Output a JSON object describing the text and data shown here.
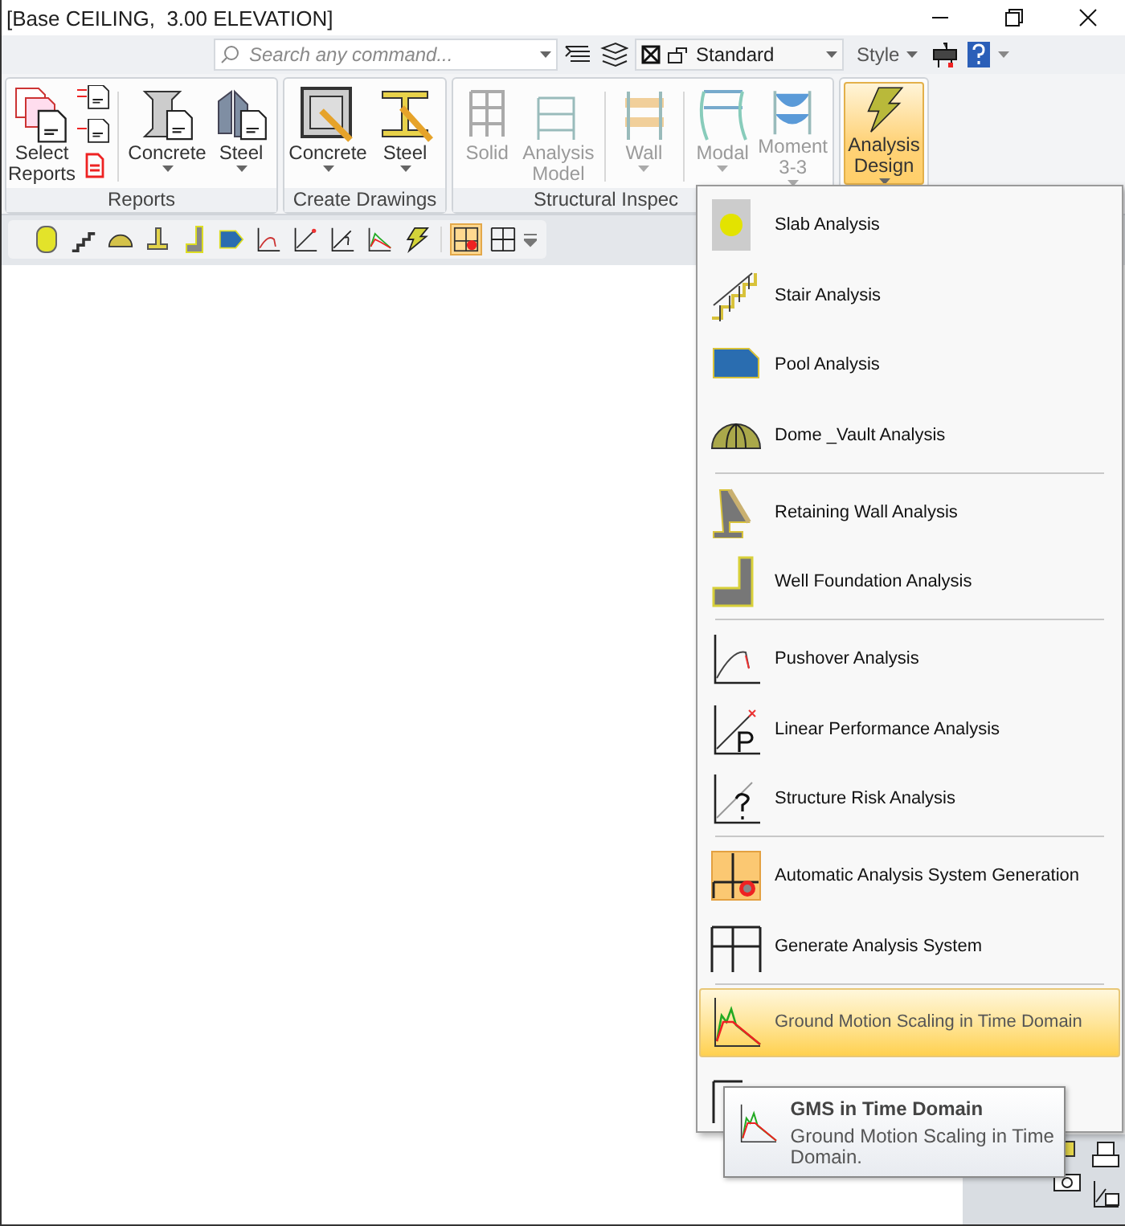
{
  "window": {
    "title": "[Base CEILING,  3.00 ELEVATION]"
  },
  "quick_bar": {
    "search": {
      "placeholder": "Search any command..."
    },
    "view_combo": "Standard",
    "style_combo": "Style"
  },
  "ribbon": {
    "groups": [
      {
        "label": "Reports",
        "buttons": [
          {
            "label": "Select\nReports",
            "dropdown": false,
            "disabled": false,
            "expanded": false
          },
          {
            "label": "Concrete",
            "dropdown": true,
            "disabled": false,
            "expanded": false
          },
          {
            "label": "Steel",
            "dropdown": true,
            "disabled": false,
            "expanded": false
          }
        ]
      },
      {
        "label": "Create Drawings",
        "buttons": [
          {
            "label": "Concrete",
            "dropdown": true,
            "disabled": false,
            "expanded": false
          },
          {
            "label": "Steel",
            "dropdown": true,
            "disabled": false,
            "expanded": false
          }
        ]
      },
      {
        "label": "Structural Inspec",
        "buttons": [
          {
            "label": "Solid",
            "dropdown": false,
            "disabled": true,
            "expanded": false
          },
          {
            "label": "Analysis\nModel",
            "dropdown": false,
            "disabled": true,
            "expanded": false
          },
          {
            "label": "Wall",
            "dropdown": true,
            "disabled": true,
            "expanded": false
          },
          {
            "label": "Modal",
            "dropdown": true,
            "disabled": true,
            "expanded": false
          },
          {
            "label": "Moment\n3-3",
            "dropdown": true,
            "disabled": true,
            "expanded": false
          }
        ]
      },
      {
        "buttons": [
          {
            "label": "Analysis\nDesign",
            "dropdown": true,
            "disabled": false,
            "expanded": true
          }
        ]
      }
    ]
  },
  "toolbar": {
    "tools": [
      {
        "selected": false
      },
      {
        "selected": false
      },
      {
        "selected": false
      },
      {
        "selected": false
      },
      {
        "selected": false
      },
      {
        "selected": false
      },
      {
        "selected": false
      },
      {
        "selected": false
      },
      {
        "selected": false
      },
      {
        "selected": false
      },
      {
        "selected": false
      },
      {
        "selected": true
      },
      {
        "selected": false
      }
    ]
  },
  "menu": {
    "sections": [
      [
        {
          "label": "Slab Analysis",
          "selected": false
        },
        {
          "label": "Stair Analysis",
          "selected": false
        },
        {
          "label": "Pool Analysis",
          "selected": false
        },
        {
          "label": "Dome _Vault Analysis",
          "selected": false
        }
      ],
      [
        {
          "label": "Retaining Wall Analysis",
          "selected": false
        },
        {
          "label": "Well Foundation Analysis",
          "selected": false
        }
      ],
      [
        {
          "label": "Pushover Analysis",
          "selected": false
        },
        {
          "label": "Linear Performance Analysis",
          "selected": false
        },
        {
          "label": "Structure Risk Analysis",
          "selected": false
        }
      ],
      [
        {
          "label": "Automatic Analysis System Generation",
          "selected": false
        },
        {
          "label": "Generate Analysis System",
          "selected": false
        }
      ],
      [
        {
          "label": "Ground Motion Scaling in Time Domain",
          "selected": true
        }
      ]
    ]
  },
  "tooltip": {
    "title": "GMS in Time Domain",
    "text": "Ground Motion Scaling in Time Domain."
  }
}
